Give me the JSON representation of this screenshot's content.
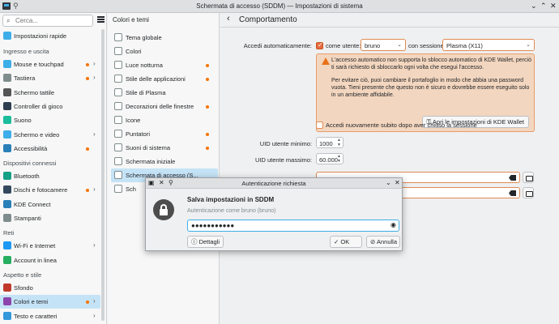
{
  "window": {
    "title": "Schermata di accesso (SDDM) — Impostazioni di sistema"
  },
  "search": {
    "placeholder": "Cerca..."
  },
  "sidebar": {
    "quick": {
      "label": "Impostazioni rapide"
    },
    "sections": [
      {
        "title": "Ingresso e uscita",
        "items": [
          {
            "label": "Mouse e touchpad",
            "dot": true,
            "chev": true
          },
          {
            "label": "Tastiera",
            "dot": true,
            "chev": true
          },
          {
            "label": "Schermo tattile",
            "dot": false,
            "chev": false
          },
          {
            "label": "Controller di gioco",
            "dot": false,
            "chev": false
          },
          {
            "label": "Suono",
            "dot": false,
            "chev": false
          },
          {
            "label": "Schermo e video",
            "dot": false,
            "chev": true
          },
          {
            "label": "Accessibilità",
            "dot": true,
            "chev": false
          }
        ]
      },
      {
        "title": "Dispositivi connessi",
        "items": [
          {
            "label": "Bluetooth",
            "dot": false,
            "chev": false
          },
          {
            "label": "Dischi e fotocamere",
            "dot": true,
            "chev": true
          },
          {
            "label": "KDE Connect",
            "dot": false,
            "chev": false
          },
          {
            "label": "Stampanti",
            "dot": false,
            "chev": false
          }
        ]
      },
      {
        "title": "Reti",
        "items": [
          {
            "label": "Wi-Fi e Internet",
            "dot": false,
            "chev": true
          },
          {
            "label": "Account in linea",
            "dot": false,
            "chev": false
          }
        ]
      },
      {
        "title": "Aspetto e stile",
        "items": [
          {
            "label": "Sfondo",
            "dot": false,
            "chev": false
          },
          {
            "label": "Colori e temi",
            "dot": true,
            "chev": true,
            "selected": true
          },
          {
            "label": "Testo e caratteri",
            "dot": false,
            "chev": true
          }
        ]
      }
    ]
  },
  "middle": {
    "title": "Colori e temi",
    "items": [
      {
        "label": "Tema globale",
        "dot": false
      },
      {
        "label": "Colori",
        "dot": false
      },
      {
        "label": "Luce notturna",
        "dot": true
      },
      {
        "label": "Stile delle applicazioni",
        "dot": true
      },
      {
        "label": "Stile di Plasma",
        "dot": false
      },
      {
        "label": "Decorazioni delle finestre",
        "dot": true
      },
      {
        "label": "Icone",
        "dot": false
      },
      {
        "label": "Puntatori",
        "dot": true
      },
      {
        "label": "Suoni di sistema",
        "dot": true
      },
      {
        "label": "Schermata iniziale",
        "dot": false
      },
      {
        "label": "Schermata di accesso (S...",
        "dot": false,
        "selected": true
      },
      {
        "label": "Sch",
        "dot": false
      }
    ]
  },
  "main": {
    "heading": "Comportamento",
    "autologin_label": "Accedi automaticamente:",
    "as_user_label": "come utente:",
    "user_value": "bruno",
    "session_label": "con sessione",
    "session_value": "Plasma (X11)",
    "warning_p1": "L'accesso automatico non supporta lo sblocco automatico di KDE Wallet, perciò ti sarà richiesto di sbloccarlo ogni volta che esegui l'accesso.",
    "warning_p2": "Per evitare ciò, puoi cambiare il portafoglio in modo che abbia una password vuota. Tieni presente che questo non è sicuro e dovrebbe essere eseguito solo in un ambiente affidabile.",
    "wallet_button": "Apri le impostazioni di KDE Wallet",
    "relogin_label": "Accedi nuovamente subito dopo aver chiuso la sessione",
    "uid_min_label": "UID utente minimo:",
    "uid_min_value": "1000",
    "uid_max_label": "UID utente massimo:",
    "uid_max_value": "60.000"
  },
  "dialog": {
    "title": "Autenticazione richiesta",
    "heading": "Salva impostazioni in SDDM",
    "subtitle": "Autenticazione come bruno (bruno)",
    "password_mask": "●●●●●●●●●●●",
    "details_button": "Dettagli",
    "ok_button": "OK",
    "cancel_button": "Annulla"
  },
  "colors": {
    "accent": "#3daee9",
    "warning": "#f67400",
    "selection": "#c5e3f6"
  }
}
